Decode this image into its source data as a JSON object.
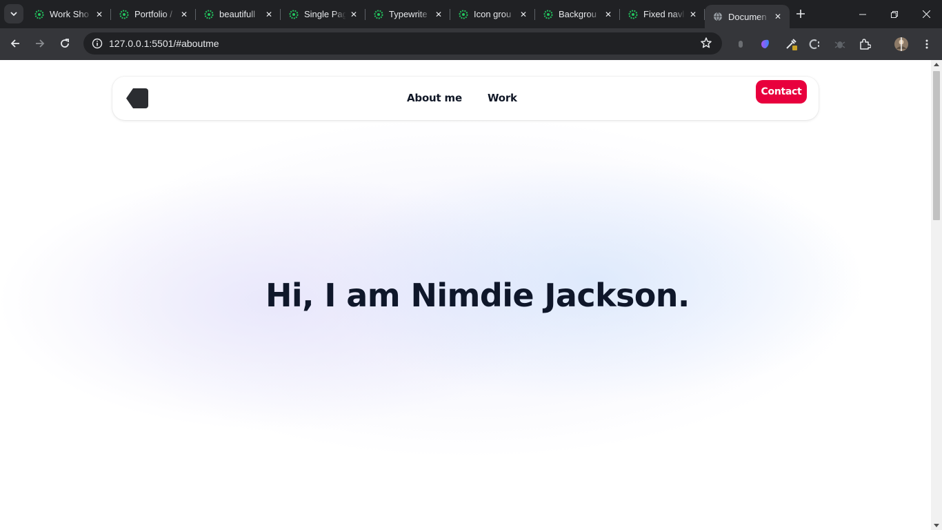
{
  "browser": {
    "tabs": [
      {
        "title": "Work Sho",
        "favicon": "codepen-icon"
      },
      {
        "title": "Portfolio /",
        "favicon": "codepen-icon"
      },
      {
        "title": "beautifull",
        "favicon": "codepen-icon"
      },
      {
        "title": "Single Pag",
        "favicon": "codepen-icon"
      },
      {
        "title": "Typewrite",
        "favicon": "codepen-icon"
      },
      {
        "title": "Icon grou",
        "favicon": "codepen-icon"
      },
      {
        "title": "Backgrou",
        "favicon": "codepen-icon"
      },
      {
        "title": "Fixed navl",
        "favicon": "codepen-icon"
      },
      {
        "title": "Documen",
        "favicon": "globe-icon",
        "active": true
      }
    ],
    "url": "127.0.0.1:5501/#aboutme"
  },
  "page": {
    "nav": {
      "links": [
        "About me",
        "Work"
      ],
      "cta": "Contact"
    },
    "hero": {
      "heading": "Hi, I am Nimdie Jackson."
    }
  },
  "colors": {
    "accent": "#e8003d",
    "heading": "#0f172a",
    "tab_bar": "#202124",
    "toolbar": "#35363a"
  }
}
